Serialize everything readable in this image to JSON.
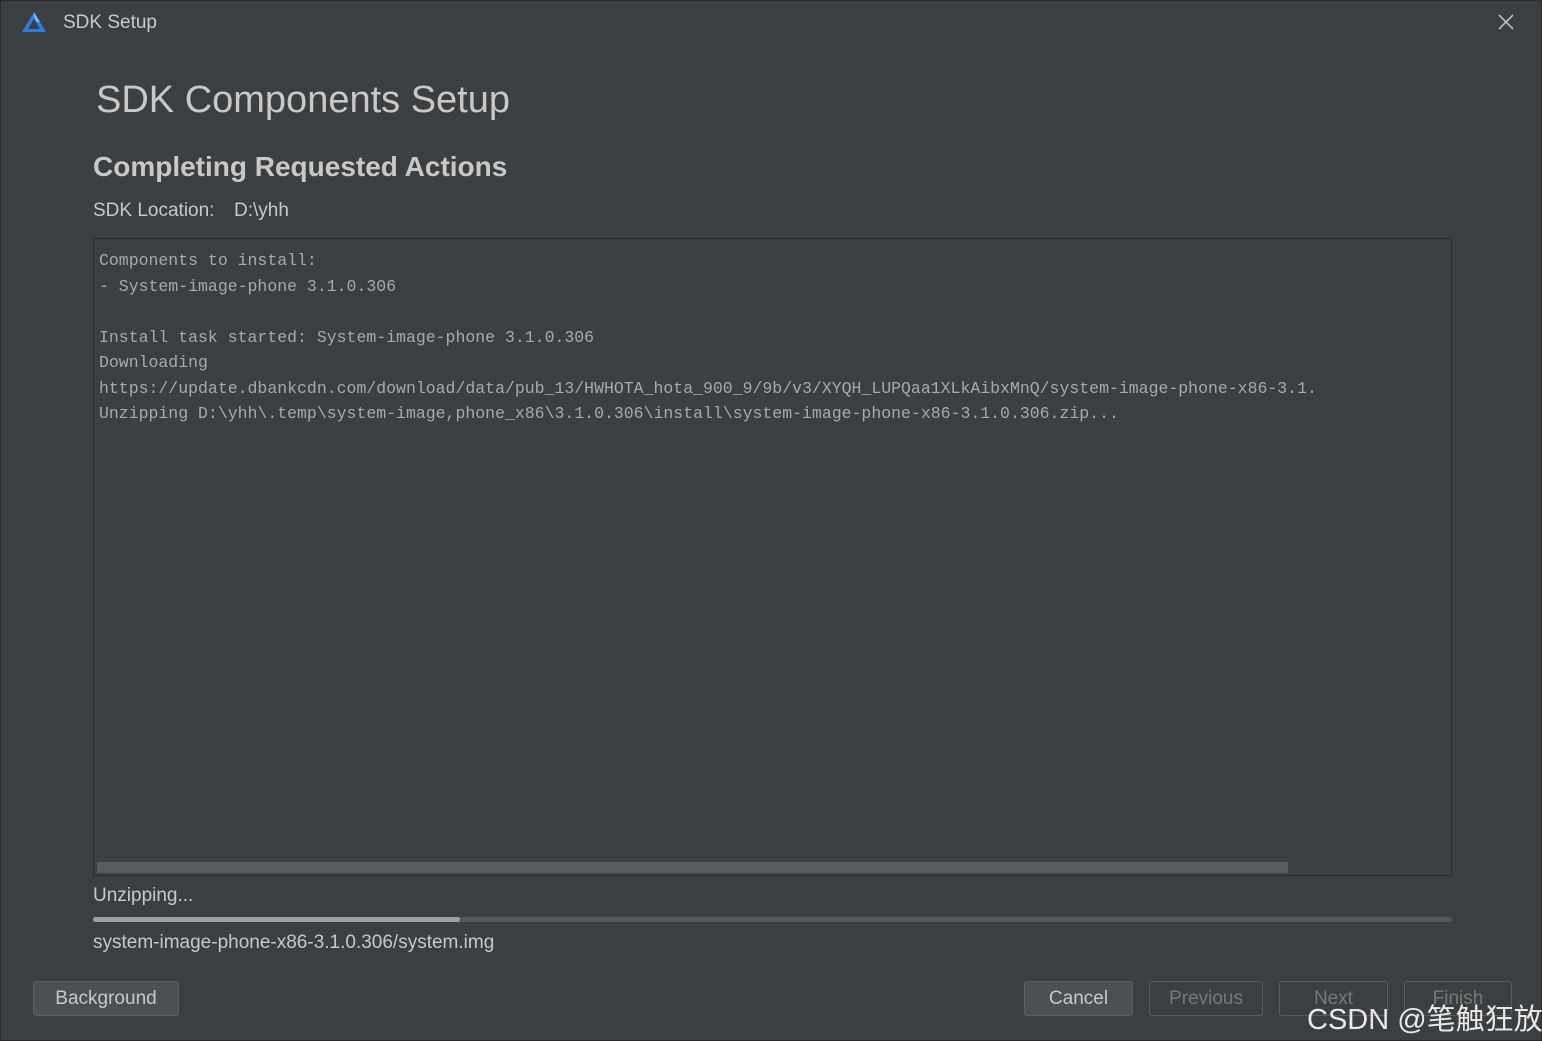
{
  "window": {
    "title": "SDK Setup"
  },
  "main": {
    "heading": "SDK Components Setup",
    "subheading": "Completing Requested Actions",
    "sdk_location_label": "SDK Location:",
    "sdk_location_value": "D:\\yhh"
  },
  "log": {
    "lines": [
      "Components to install:",
      "- System-image-phone 3.1.0.306",
      "",
      "Install task started: System-image-phone 3.1.0.306",
      "Downloading",
      "https://update.dbankcdn.com/download/data/pub_13/HWHOTA_hota_900_9/9b/v3/XYQH_LUPQaa1XLkAibxMnQ/system-image-phone-x86-3.1.",
      "Unzipping D:\\yhh\\.temp\\system-image,phone_x86\\3.1.0.306\\install\\system-image-phone-x86-3.1.0.306.zip..."
    ]
  },
  "progress": {
    "status": "Unzipping...",
    "fraction": 0.27,
    "current_file": "system-image-phone-x86-3.1.0.306/system.img"
  },
  "buttons": {
    "background": "Background",
    "cancel": "Cancel",
    "previous": "Previous",
    "next": "Next",
    "finish": "Finish"
  },
  "watermark": "CSDN @笔触狂放",
  "colors": {
    "background": "#3c3f41",
    "text": "#c8c8c8",
    "log_text": "#a9a9a9",
    "progress_fill": "#a0a0a0",
    "progress_track": "#555759",
    "logo_blue": "#2f7be0",
    "logo_light": "#7fb4ff"
  }
}
